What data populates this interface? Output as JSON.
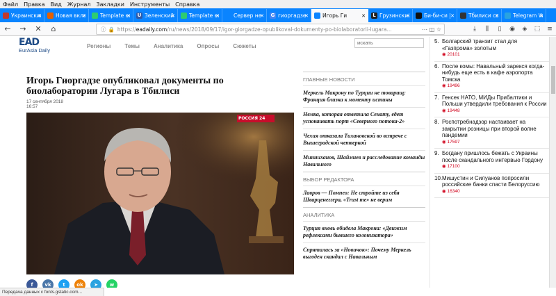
{
  "menu": [
    "Файл",
    "Правка",
    "Вид",
    "Журнал",
    "Закладки",
    "Инструменты",
    "Справка"
  ],
  "tabs": [
    {
      "title": "Украинский",
      "color": "#c0392b",
      "glyph": "",
      "active": false
    },
    {
      "title": "Новая вклад",
      "color": "#e66000",
      "glyph": "",
      "active": false
    },
    {
      "title": "Template ed",
      "color": "#2ecc71",
      "glyph": "",
      "active": false
    },
    {
      "title": "Зеленский",
      "color": "#2f5aa8",
      "glyph": "U",
      "active": false
    },
    {
      "title": "Template ed",
      "color": "#2ecc71",
      "glyph": "",
      "active": false
    },
    {
      "title": "Сервер не н",
      "color": "#0a84ff",
      "glyph": "",
      "active": false
    },
    {
      "title": "гиоргадзе",
      "color": "#4285f4",
      "glyph": "G",
      "active": false
    },
    {
      "title": "Игорь Ги",
      "color": "#f9f9fa",
      "glyph": "",
      "active": true
    },
    {
      "title": "Грузинский",
      "color": "#222222",
      "glyph": "L",
      "active": false
    },
    {
      "title": "Би-би-си |",
      "color": "#111111",
      "glyph": "",
      "active": false
    },
    {
      "title": "Тбилиси со",
      "color": "#333333",
      "glyph": "",
      "active": false
    },
    {
      "title": "Telegram We",
      "color": "#2aa3e0",
      "glyph": "",
      "active": false
    }
  ],
  "nav": {
    "back": "←",
    "forward": "→",
    "reload": "✕",
    "home": "⌂",
    "url_scheme": "https://",
    "url_host": "eadaily.com",
    "url_path": "/ru/news/2018/09/17/igor-giorgadze-opublikoval-dokumenty-po-biolaboratorii-lugara..."
  },
  "site": {
    "logo_mark": "EAD",
    "logo_sub": "EurAsia Daily",
    "nav": [
      "Регионы",
      "Темы",
      "Аналитика",
      "Опросы",
      "Сюжеты"
    ],
    "search_placeholder": "искать"
  },
  "article": {
    "title": "Игорь Гиоргадзе опубликовал документы по биолаборатории Лугара в Тбилиси",
    "date": "17 сентября 2018",
    "time": "16:57",
    "channel_logo": "РОССИЯ 24"
  },
  "share": [
    {
      "name": "facebook",
      "label": "f",
      "color": "#3b5998"
    },
    {
      "name": "vk",
      "label": "vk",
      "color": "#4a76a8"
    },
    {
      "name": "twitter",
      "label": "t",
      "color": "#1da1f2"
    },
    {
      "name": "odnoklassniki",
      "label": "ok",
      "color": "#ee8208"
    },
    {
      "name": "telegram",
      "label": "➤",
      "color": "#2aa3e0"
    },
    {
      "name": "whatsapp",
      "label": "w",
      "color": "#25d366"
    }
  ],
  "main_news": {
    "heading": "ГЛАВНЫЕ НОВОСТИ",
    "items": [
      "Меркель Макрону по Турции не товарищ: Франция близка к моменту истины",
      "Немка, которая ответила Сенату, едет успокаивать порт «Северного потока-2»",
      "Чехия отказала Тихановской во встрече с Вышеградской четверкой",
      "Минниханов, Шаймиев и расследование команды Навального"
    ]
  },
  "editor_choice": {
    "heading": "ВЫБОР РЕДАКТОРА",
    "items": [
      "Лавров — Помпео: Не стройте из себя Шварценеггера, «Trust me» не верим"
    ]
  },
  "analytics": {
    "heading": "АНАЛИТИКА",
    "items": [
      "Турция вновь обидела Макрона: «Движим рефлексами бывшего колонизатора»",
      "Спряталась за «Новичок»: Почему Меркель выгоден скандал с Навальным"
    ]
  },
  "popular": [
    {
      "num": "5.",
      "text": "Болгарский транзит стал для «Газпрома» золотым",
      "views": "20101"
    },
    {
      "num": "6.",
      "text": "После комы: Навальный зарекся когда-нибудь еще есть в кафе аэропорта Томска",
      "views": "19496"
    },
    {
      "num": "7.",
      "text": "Генсек НАТО, МИДы Прибалтики и Польши утвердили требования к России",
      "views": "19448"
    },
    {
      "num": "8.",
      "text": "Роспотребнадзор настаивает на закрытии розницы при второй волне пандемии",
      "views": "17597"
    },
    {
      "num": "9.",
      "text": "Богдану пришлось бежать с Украины после скандального интервью Гордону",
      "views": "17100"
    },
    {
      "num": "10.",
      "text": "Мишустин и Силуанов попросили российские банки спасти Белоруссию",
      "views": "16340"
    }
  ],
  "status": "Передача данных с fonts.gstatic.com..."
}
